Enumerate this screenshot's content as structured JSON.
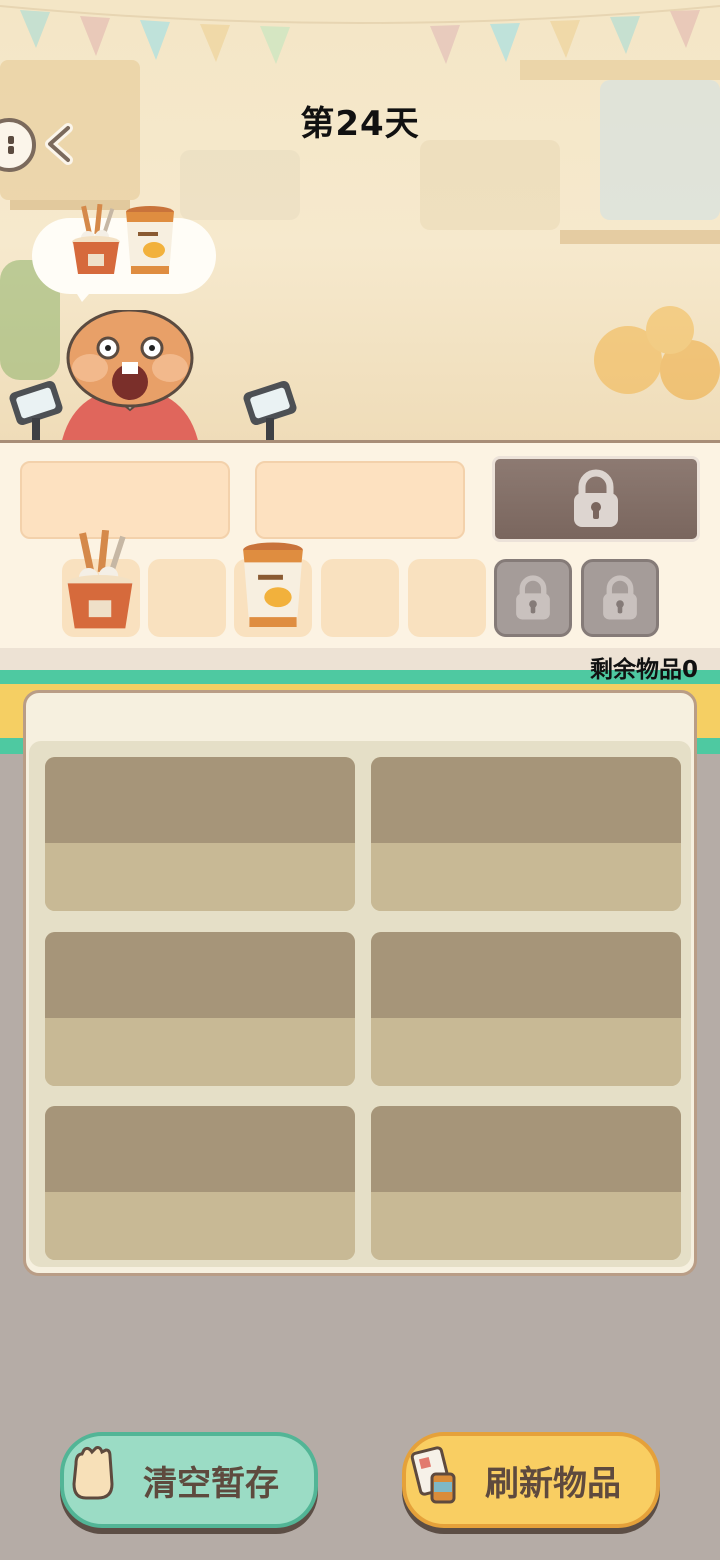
{
  "header": {
    "day_title": "第24天"
  },
  "customer": {
    "order_items": [
      "oden-cup-icon",
      "mango-ice-cream-icon"
    ]
  },
  "counter": {
    "remaining_label": "剩余物品0",
    "temp_slots": [
      {
        "state": "occupied",
        "item": "oden-cup-icon"
      },
      {
        "state": "empty"
      },
      {
        "state": "occupied",
        "item": "mango-ice-cream-icon"
      },
      {
        "state": "empty"
      },
      {
        "state": "empty"
      },
      {
        "state": "locked"
      },
      {
        "state": "locked"
      }
    ]
  },
  "buttons": {
    "clear_label": "清空暂存",
    "refresh_label": "刷新物品"
  },
  "colors": {
    "teal_accent": "#4ec9a1",
    "yellow_accent": "#f5cf63",
    "clear_button": "#9bdcc5",
    "refresh_button": "#f9ce62",
    "panel_bg": "#f6f0df",
    "shelf_dark": "#a69579",
    "shelf_light": "#c8b995"
  }
}
